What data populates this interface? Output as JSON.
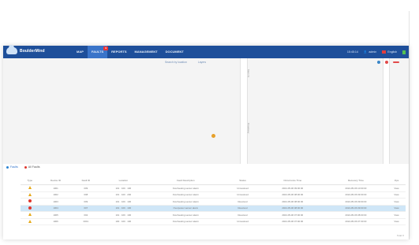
{
  "app": {
    "name": "BoulderMind"
  },
  "nav": {
    "menu": [
      {
        "label": "MAP",
        "active": false
      },
      {
        "label": "FAULTS",
        "active": true,
        "badge": "9"
      },
      {
        "label": "REPORTS",
        "active": false
      },
      {
        "label": "MANAGEMENT",
        "active": false
      },
      {
        "label": "DOCUMENT",
        "active": false
      }
    ],
    "right": {
      "time": "15:45:14",
      "user": "admin",
      "language": "English"
    }
  },
  "map": {
    "tools": [
      "Search by location",
      "Layers"
    ],
    "road_labels": [
      "Main St",
      "Broadway"
    ]
  },
  "tabs": [
    {
      "label": "Faults",
      "active": true
    },
    {
      "label": "All Faults",
      "active": false
    }
  ],
  "table": {
    "columns": [
      "Type",
      "Device ID",
      "Fault ID",
      "Location",
      "Fault Description",
      "Status",
      "Occurrence Time",
      "Recovery Time",
      "Ops"
    ],
    "rows": [
      {
        "sev": "warn",
        "device": "1001",
        "fault": "009",
        "loc": "101 · 100 · 100",
        "desc": "Overheating sensor alarm",
        "status": "Unresolved",
        "st": "red",
        "t1": "2024-05-06 09:00:00",
        "t2": "2024-05-06 10:00:00",
        "op": "View",
        "sel": false
      },
      {
        "sev": "warn",
        "device": "1002",
        "fault": "008",
        "loc": "101 · 100 · 200",
        "desc": "Overheating sensor alarm",
        "status": "Unresolved",
        "st": "red",
        "t1": "2024-05-06 08:00:00",
        "t2": "2024-05-06 09:30:00",
        "op": "View",
        "sel": false
      },
      {
        "sev": "crit",
        "device": "1003",
        "fault": "009",
        "loc": "101 · 100 · 100",
        "desc": "Overheating sensor alarm",
        "status": "Resolved",
        "st": "blue",
        "t1": "2024-05-06 08:00:00",
        "t2": "2024-05-06 09:00:00",
        "op": "View",
        "sel": false
      },
      {
        "sev": "crit",
        "device": "1004",
        "fault": "007",
        "loc": "101 · 100 · 100",
        "desc": "Overpower sensor alarm",
        "status": "Resolved",
        "st": "blue",
        "t1": "2024-05-06 08:00:00",
        "t2": "2024-05-06 09:00:00",
        "op": "View",
        "sel": true
      },
      {
        "sev": "warn",
        "device": "1005",
        "fault": "002",
        "loc": "101 · 100 · 100",
        "desc": "Overheating sensor alarm",
        "status": "Resolved",
        "st": "blue",
        "t1": "2024-05-06 07:00:00",
        "t2": "2024-05-06 08:00:00",
        "op": "View",
        "sel": false
      },
      {
        "sev": "warn",
        "device": "1006",
        "fault": "0001",
        "loc": "100 · 100 · 100",
        "desc": "Overheating sensor alarm",
        "status": "Unresolved",
        "st": "red",
        "t1": "2024-05-06 07:00:00",
        "t2": "2024-05-06 07:30:00",
        "op": "View",
        "sel": false
      }
    ]
  },
  "footer": {
    "total": "Total: 6"
  }
}
